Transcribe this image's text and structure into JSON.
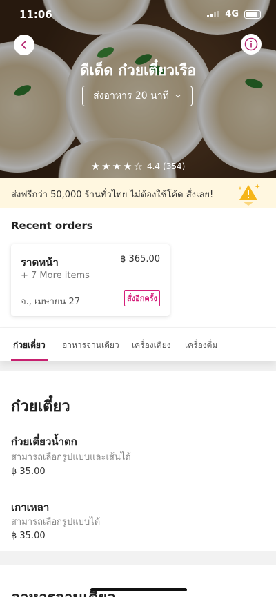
{
  "status_bar": {
    "time": "11:06",
    "network": "4G"
  },
  "header": {
    "restaurant_name": "ดีเด็ด ก๋วยเตี๋ยวเรือ",
    "delivery_time": "ส่งอาหาร 20 นาที",
    "rating_value": "4.4",
    "rating_count": "(354)",
    "rating_stars": 4.5
  },
  "promo": {
    "text": "ส่งฟรีกว่า 50,000 ร้านทั่วไทย ไม่ต้องใช้โค้ด สั่งเลย!"
  },
  "recent_orders": {
    "title": "Recent orders",
    "order": {
      "name": "ราดหน้า",
      "price": "฿ 365.00",
      "more_items": "+ 7 More items",
      "date": "จ., เมษายน 27",
      "reorder_label": "สั่งอีกครั้ง"
    }
  },
  "tabs": [
    {
      "label": "ก๋วยเตี๋ยว",
      "active": true
    },
    {
      "label": "อาหารจานเดียว",
      "active": false
    },
    {
      "label": "เครื่องเคียง",
      "active": false
    },
    {
      "label": "เครื่องดื่ม",
      "active": false
    }
  ],
  "menu": {
    "category_title": "ก๋วยเตี๋ยว",
    "items": [
      {
        "name": "ก๋วยเตี๋ยวน้ำตก",
        "description": "สามารถเลือกรูปแบบและเส้นได้",
        "price": "฿ 35.00"
      },
      {
        "name": "เกาเหลา",
        "description": "สามารถเลือกรูปแบบได้",
        "price": "฿ 35.00"
      }
    ],
    "next_category_title": "อาหารจานเดียว"
  },
  "colors": {
    "accent": "#c7206f",
    "promo_bg": "#fff7e0"
  },
  "icons": {
    "back": "chevron-left-icon",
    "info": "info-icon",
    "dropdown": "chevron-down-icon",
    "promo": "warning-sparkle-icon"
  }
}
